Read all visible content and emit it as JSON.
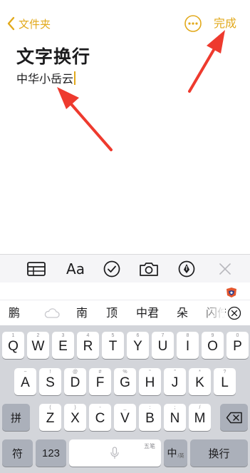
{
  "nav": {
    "back_label": "文件夹",
    "done_label": "完成"
  },
  "note": {
    "title": "文字换行",
    "body": "中华小岳云"
  },
  "toolbar": {
    "format_label": "Aa"
  },
  "candidates": [
    "鹏",
    "南",
    "顶",
    "中君",
    "朵",
    "闪佇"
  ],
  "keyboard": {
    "row1": [
      {
        "key": "Q",
        "hint": "1"
      },
      {
        "key": "W",
        "hint": "2"
      },
      {
        "key": "E",
        "hint": "3"
      },
      {
        "key": "R",
        "hint": "4"
      },
      {
        "key": "T",
        "hint": "5"
      },
      {
        "key": "Y",
        "hint": "6"
      },
      {
        "key": "U",
        "hint": "7"
      },
      {
        "key": "I",
        "hint": "8"
      },
      {
        "key": "O",
        "hint": "9"
      },
      {
        "key": "P",
        "hint": "0"
      }
    ],
    "row2": [
      {
        "key": "A",
        "hint": "~"
      },
      {
        "key": "S",
        "hint": "!"
      },
      {
        "key": "D",
        "hint": "@"
      },
      {
        "key": "F",
        "hint": "#"
      },
      {
        "key": "G",
        "hint": "%"
      },
      {
        "key": "H",
        "hint": "“"
      },
      {
        "key": "J",
        "hint": "”"
      },
      {
        "key": "K",
        "hint": "*"
      },
      {
        "key": "L",
        "hint": "?"
      }
    ],
    "row3": [
      {
        "key": "Z",
        "hint": "("
      },
      {
        "key": "X",
        "hint": ")"
      },
      {
        "key": "C",
        "hint": "-"
      },
      {
        "key": "V",
        "hint": "_"
      },
      {
        "key": "B",
        "hint": ":"
      },
      {
        "key": "N",
        "hint": ";"
      },
      {
        "key": "M",
        "hint": "/"
      }
    ],
    "pinyin_label": "拼",
    "symbol_label": "符",
    "number_label": "123",
    "space_hint": "五笔",
    "lang_label": "中",
    "lang_sub": "/英",
    "return_label": "换行"
  },
  "colors": {
    "accent": "#e2a91b",
    "arrow": "#ee3a2e"
  },
  "icons": [
    "chevron-left-icon",
    "more-icon",
    "table-icon",
    "checklist-icon",
    "camera-icon",
    "markup-icon",
    "close-icon",
    "cloud-icon",
    "delete-icon",
    "mic-icon"
  ]
}
